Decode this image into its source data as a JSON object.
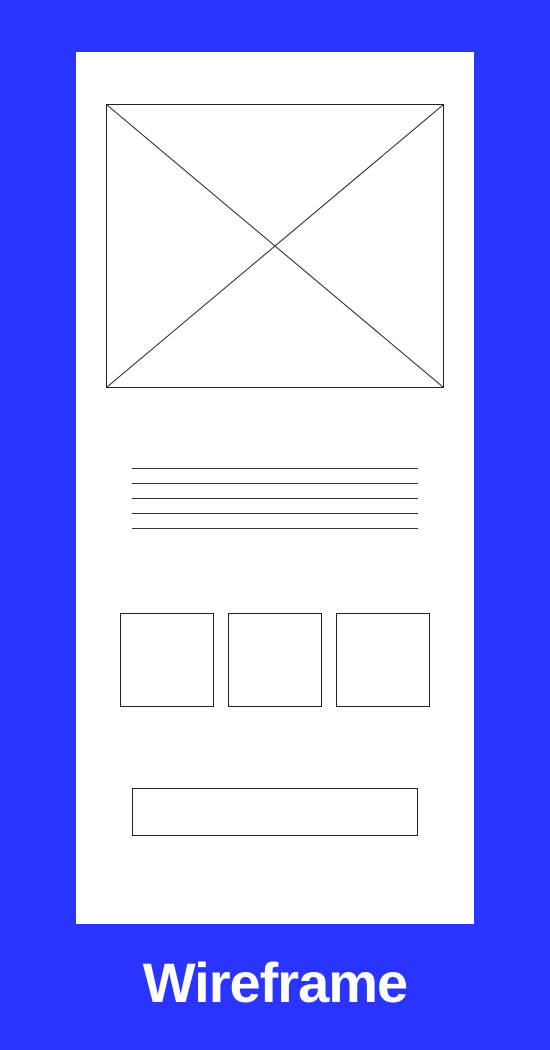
{
  "title": "Wireframe",
  "colors": {
    "background": "#2934FF",
    "canvas": "#ffffff",
    "stroke": "#222222"
  },
  "wireframe": {
    "hero_image_placeholder": "image-placeholder",
    "text_line_count": 5,
    "thumbnails": [
      "thumb-1",
      "thumb-2",
      "thumb-3"
    ],
    "cta_placeholder": "button-placeholder"
  }
}
